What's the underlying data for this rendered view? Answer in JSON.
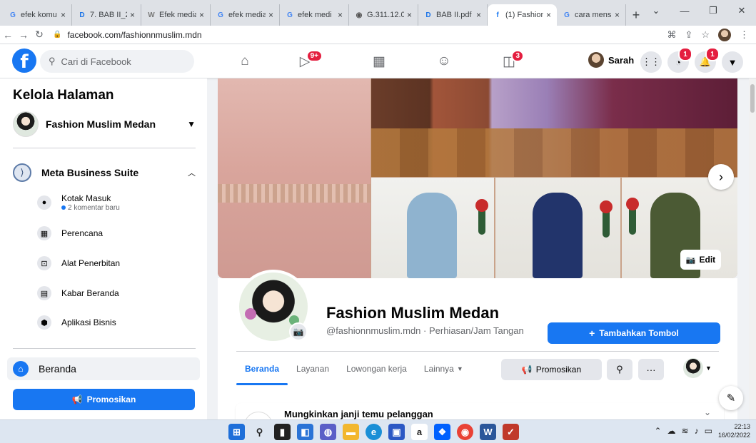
{
  "browser": {
    "tabs": [
      {
        "title": "efek komu",
        "favicon": "G",
        "color": "#4285f4",
        "active": false
      },
      {
        "title": "7. BAB II_2",
        "favicon": "D",
        "color": "#1a73e8",
        "active": false
      },
      {
        "title": "Efek media",
        "favicon": "W",
        "color": "#777777",
        "active": false
      },
      {
        "title": "efek media",
        "favicon": "G",
        "color": "#4285f4",
        "active": false
      },
      {
        "title": "efek medi",
        "favicon": "G",
        "color": "#4285f4",
        "active": false
      },
      {
        "title": "G.311.12.0",
        "favicon": "◉",
        "color": "#555555",
        "active": false
      },
      {
        "title": "BAB II.pdf",
        "favicon": "D",
        "color": "#1a73e8",
        "active": false
      },
      {
        "title": "(1) Fashion",
        "favicon": "f",
        "color": "#1877f2",
        "active": true
      },
      {
        "title": "cara mens",
        "favicon": "G",
        "color": "#4285f4",
        "active": false
      }
    ],
    "url": "facebook.com/fashionnmuslim.mdn"
  },
  "fb_header": {
    "search_placeholder": "Cari di Facebook",
    "video_badge": "9+",
    "groups_badge": "3",
    "user_name": "Sarah",
    "messenger_badge": "1",
    "notif_badge": "1"
  },
  "sidebar": {
    "title": "Kelola Halaman",
    "page_name": "Fashion Muslim Medan",
    "meta_suite": "Meta Business Suite",
    "items": [
      {
        "label": "Kotak Masuk",
        "sub": "2 komentar baru",
        "icon": "chat-icon"
      },
      {
        "label": "Perencana",
        "sub": "",
        "icon": "calendar-icon"
      },
      {
        "label": "Alat Penerbitan",
        "sub": "",
        "icon": "publish-icon"
      },
      {
        "label": "Kabar Beranda",
        "sub": "",
        "icon": "news-feed-icon"
      },
      {
        "label": "Aplikasi Bisnis",
        "sub": "",
        "icon": "box-icon"
      }
    ],
    "home_label": "Beranda",
    "promote_label": "Promosikan"
  },
  "profile": {
    "name": "Fashion Muslim Medan",
    "handle": "@fashionnmuslim.mdn · Perhiasan/Jam Tangan",
    "add_button": "Tambahkan Tombol",
    "edit_cover": "Edit",
    "tabs": [
      "Beranda",
      "Layanan",
      "Lowongan kerja",
      "Lainnya"
    ],
    "promote_label": "Promosikan"
  },
  "card": {
    "title": "Mungkinkan janji temu pelanggan"
  },
  "taskbar": {
    "time": "22:13",
    "date": "16/02/2022"
  }
}
